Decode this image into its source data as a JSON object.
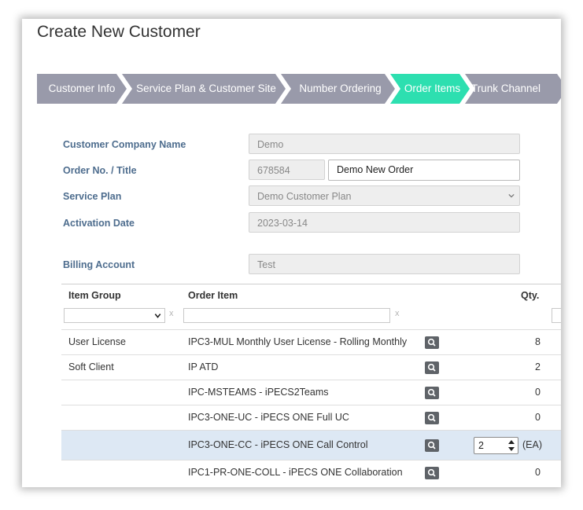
{
  "page": {
    "title": "Create New Customer"
  },
  "steps": [
    {
      "label": "Customer Info",
      "active": false
    },
    {
      "label": "Service Plan & Customer Site",
      "active": false
    },
    {
      "label": "Number Ordering",
      "active": false
    },
    {
      "label": "Order Items",
      "active": true
    },
    {
      "label": "Trunk Channel",
      "active": false
    }
  ],
  "form": {
    "company_label": "Customer Company Name",
    "company_value": "Demo",
    "order_label": "Order No. / Title",
    "order_no": "678584",
    "order_title": "Demo New Order",
    "plan_label": "Service Plan",
    "plan_value": "Demo Customer Plan",
    "activation_label": "Activation Date",
    "activation_value": "2023-03-14",
    "billing_label": "Billing Account",
    "billing_value": "Test"
  },
  "table": {
    "headers": {
      "group": "Item Group",
      "item": "Order Item",
      "qty": "Qty."
    },
    "filter_clear": "x",
    "rows": [
      {
        "group": "User License",
        "item": "IPC3-MUL Monthly User License - Rolling Monthly",
        "qty": "8"
      },
      {
        "group": "Soft Client",
        "item": "IP ATD",
        "qty": "2"
      },
      {
        "group": "",
        "item": "IPC-MSTEAMS - iPECS2Teams",
        "qty": "0"
      },
      {
        "group": "",
        "item": "IPC3-ONE-UC - iPECS ONE Full UC",
        "qty": "0"
      },
      {
        "group": "",
        "item": "IPC3-ONE-CC - iPECS ONE Call Control",
        "qty": "2",
        "unit": "(EA)",
        "editing": true
      },
      {
        "group": "",
        "item": "IPC1-PR-ONE-COLL - iPECS ONE Collaboration",
        "qty": "0"
      }
    ]
  },
  "colors": {
    "step_inactive": "#999aaa",
    "step_active": "#2ddfb0",
    "label_blue": "#4e6d8e",
    "row_highlight": "#dde8f4"
  }
}
